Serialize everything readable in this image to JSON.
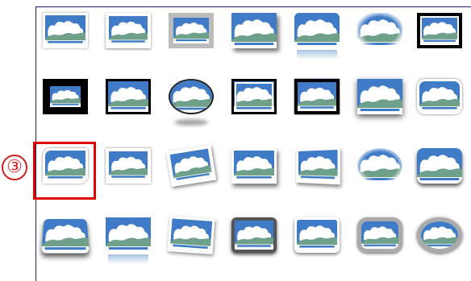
{
  "callout": {
    "marker": "③"
  },
  "gallery": {
    "selected_index": 14,
    "styles": [
      "simple-frame-white",
      "beveled-matte-white",
      "metal-frame",
      "drop-shadow-rectangle",
      "reflected-rounded-rectangle",
      "soft-edge-rectangle",
      "double-frame-black",
      "thick-matte-black",
      "simple-frame-black",
      "beveled-oval-black",
      "compound-frame-black",
      "moderate-frame-black",
      "center-shadow-rectangle",
      "rounded-diagonal-corner-white",
      "snip-diagonal-corner-white",
      "moderate-frame-white",
      "rotated-white",
      "perspective-shadow-white",
      "relaxed-perspective-white",
      "soft-edge-oval",
      "bevel-rectangle",
      "bevel-perspective",
      "reflected-bevel-white",
      "bevel-perspective-left-white",
      "metal-rounded-rectangle",
      "reflected-perspective-right",
      "metal-oval",
      "bevel-ellipse"
    ]
  },
  "colors": {
    "sky": "#3f7bc6",
    "cloud": "#ffffff",
    "hill": "#6fa08a",
    "highlight": "#e00000"
  }
}
